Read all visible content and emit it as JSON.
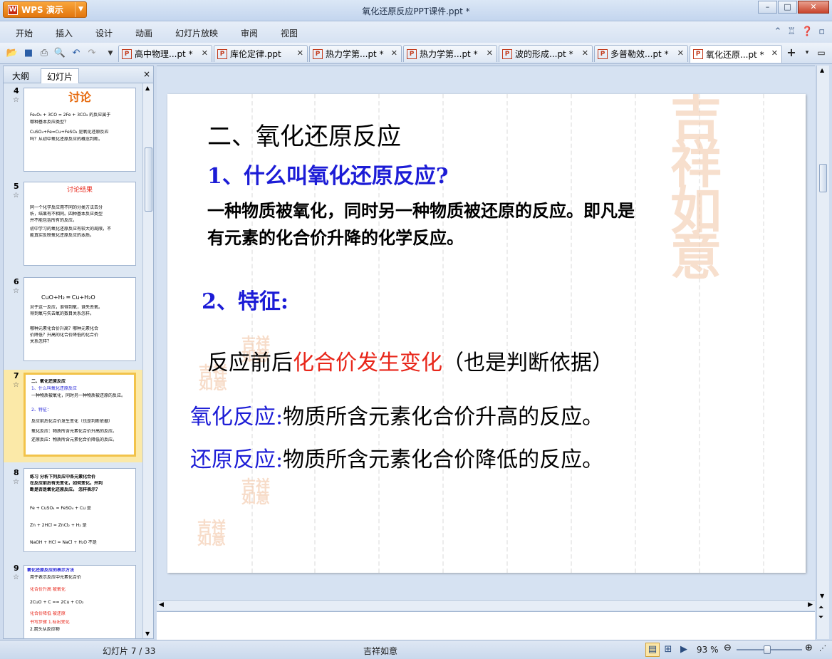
{
  "app": {
    "button_label": "WPS 演示",
    "window_title": "氧化还原反应PPT课件.ppt *"
  },
  "menu": [
    "开始",
    "插入",
    "设计",
    "动画",
    "幻灯片放映",
    "审阅",
    "视图"
  ],
  "doc_tabs": [
    {
      "label": "高中物理...pt *",
      "active": false
    },
    {
      "label": "库伦定律.ppt",
      "active": false
    },
    {
      "label": "热力学第...pt *",
      "active": false
    },
    {
      "label": "热力学第...pt *",
      "active": false
    },
    {
      "label": "波的形成...pt *",
      "active": false
    },
    {
      "label": "多普勒效...pt *",
      "active": false
    },
    {
      "label": "氧化还原...pt *",
      "active": true
    }
  ],
  "panel": {
    "tab_outline": "大纲",
    "tab_slides": "幻灯片",
    "close": "×"
  },
  "thumbnails": [
    {
      "number": "4",
      "title": "讨论",
      "lines": [
        "Fe₂O₃ + 3CO = 2Fe + 3CO₂ 的反应属于",
        "哪种基本反应类型？",
        "CuSO₄+Fe=Cu+FeSO₄ 是氧化还原反应",
        "吗？从初中氧化还原反应的概念判断。"
      ]
    },
    {
      "number": "5",
      "title": "讨论结果",
      "lines": [
        "同一个化学反应用不同的分类方法去分",
        "析，结果有不相同。四种基本反应类型",
        "并不能包括所有的反应。",
        "初中学习的氧化还原反应有较大的局限，不",
        "能真实反映氧化还原反应的本质。"
      ]
    },
    {
      "number": "6",
      "title": "",
      "lines": [
        "CuO+H₂ ═ Cu+H₂O",
        "对于这一反应，谁得到氧，谁失去氧。",
        "得到氧与失去氧的数目关系怎样。",
        "",
        "哪种元素化合价升高？哪种元素化合",
        "价降低？升高的化合价降低的化合价",
        "关系怎样？"
      ]
    },
    {
      "number": "7",
      "title": "二、氧化还原反应",
      "lines": [
        "1、什么叫氧化还原反应",
        "一种物质被氧化，同时另一种物质被还原的反应。",
        "2、特征：",
        "反应前后化合价发生变化（也是判断依据）",
        "氧化反应：物质所含元素化合价升高的反应。",
        "还原反应：物质所含元素化合价降低的反应。"
      ]
    },
    {
      "number": "8",
      "title": "",
      "lines": [
        "练习  分析下列反应中各元素化合价",
        "在反应前后有无变化，如何变化。并判",
        "断是否是氧化还原反应。 怎样表示？",
        "Fe + CuSO₄ = FeSO₄ + Cu    是",
        "Zn + 2HCl = ZnCl₂ + H₂     是",
        "NaOH + HCl = NaCl + H₂O    不是"
      ]
    },
    {
      "number": "9",
      "title": "氧化还原反应的表示方法",
      "lines": [
        "用于表示反应中元素化合价",
        "化合价升高  被氧化",
        "2CuO + C == 2Cu + CO₂",
        "化合价降低  被还原",
        "书写步骤  1.标出变化",
        "2.箭头从反应物"
      ]
    }
  ],
  "slide": {
    "title": "二、氧化还原反应",
    "question": "1、什么叫氧化还原反应?",
    "definition_line1": "一种物质被氧化，同时另一种物质被还原的反应。即凡是",
    "definition_line2": "有元素的化合价升降的化学反应。",
    "feature_heading": "2、特征:",
    "basis_prefix": "反应前后",
    "basis_highlight": "化合价发生变化",
    "basis_suffix": "（也是判断依据）",
    "oxidation_term": "氧化反应:",
    "oxidation_desc": "物质所含元素化合价升高的反应。",
    "reduction_term": "还原反应:",
    "reduction_desc": "物质所含元素化合价降低的反应。",
    "seal_text": "吉祥如意"
  },
  "status": {
    "slide_position": "幻灯片 7 / 33",
    "theme": "吉祥如意",
    "zoom": "93 %",
    "zoom_level_percent": 93
  },
  "colors": {
    "accent_blue": "#1c1cd6",
    "accent_red": "#e8261a",
    "seal": "#f2c6a6",
    "selection": "#f2c34a"
  }
}
